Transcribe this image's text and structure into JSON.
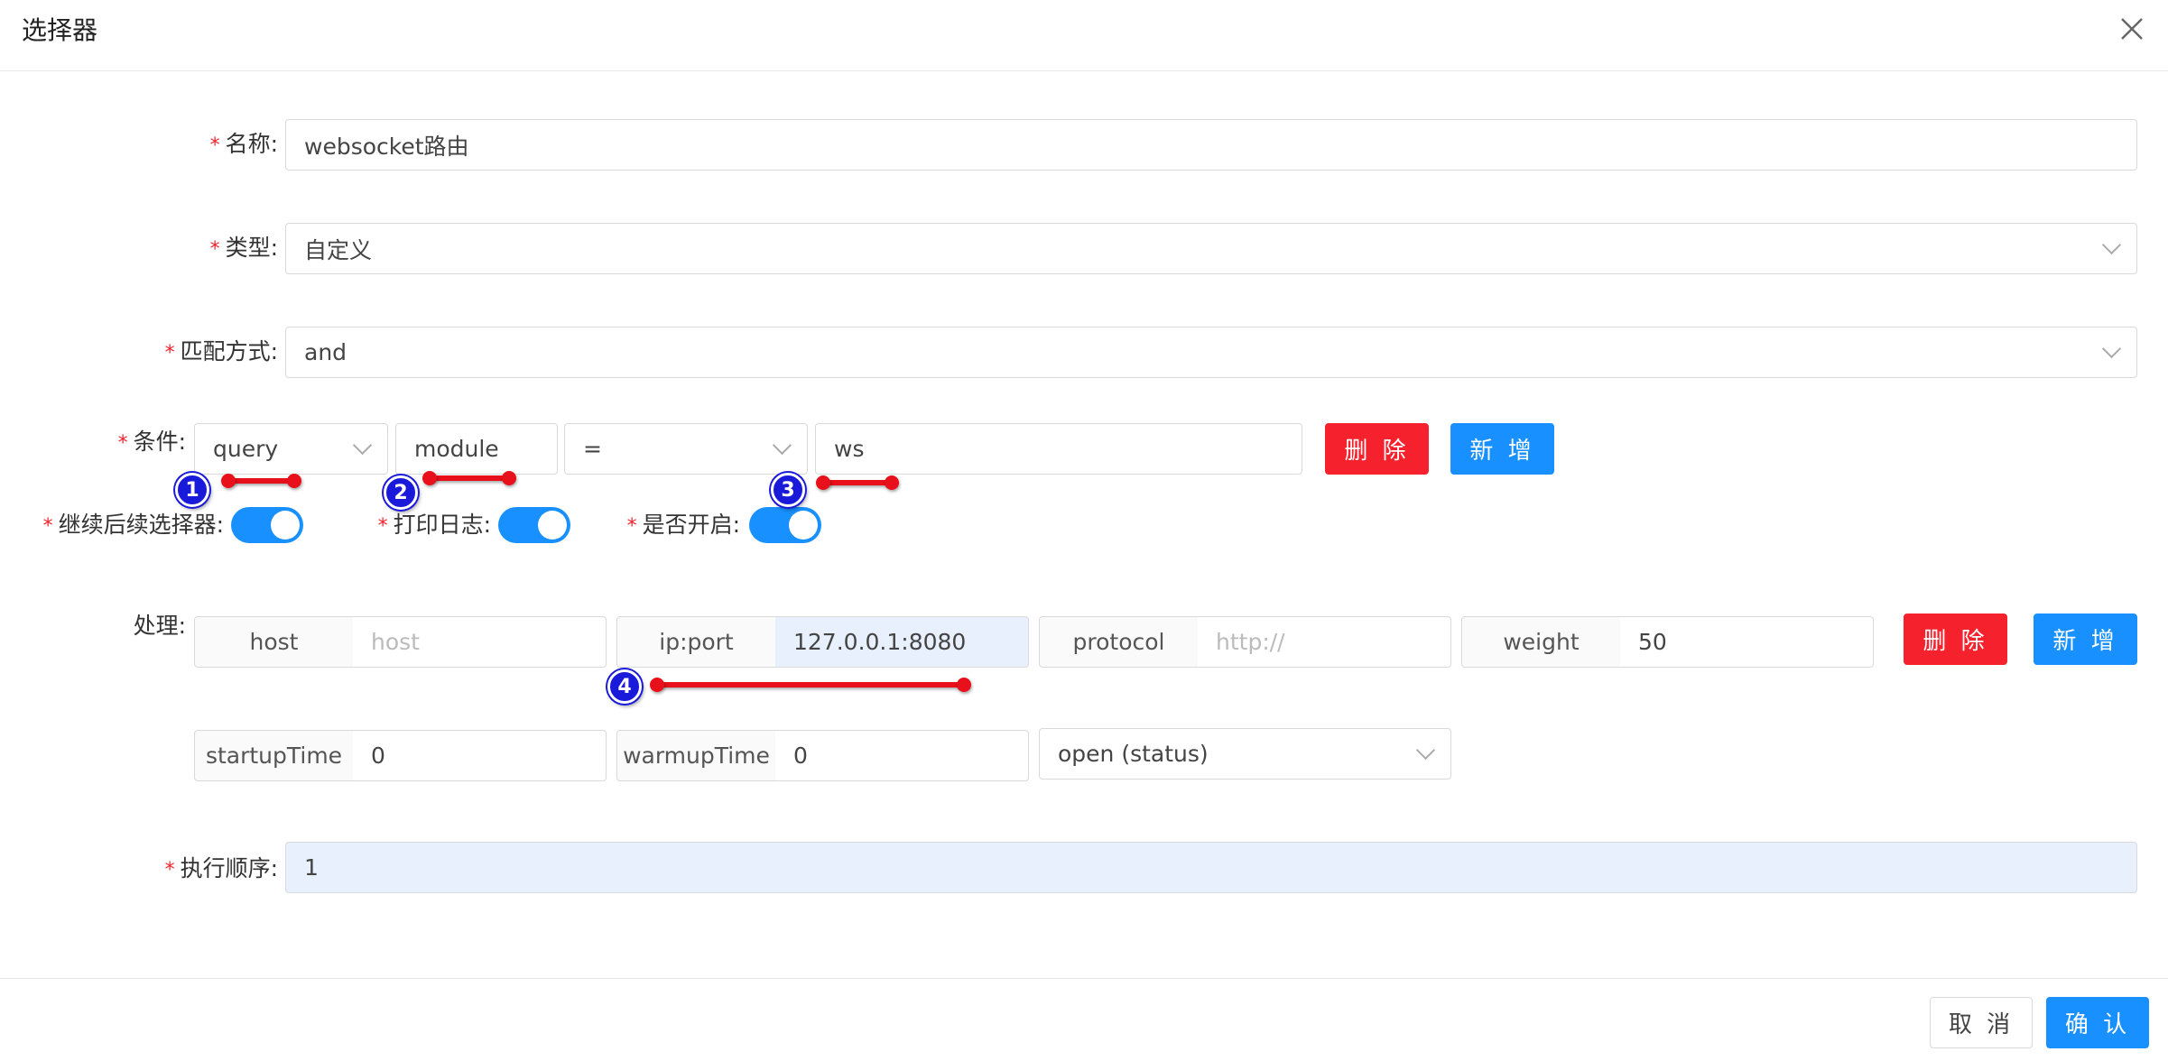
{
  "dialog": {
    "title": "选择器",
    "fields": {
      "name": {
        "label": "名称:",
        "value": "websocket路由"
      },
      "type": {
        "label": "类型:",
        "value": "自定义"
      },
      "match_mode": {
        "label": "匹配方式:",
        "value": "and"
      },
      "condition": {
        "label": "条件:",
        "param_type": "query",
        "param_name": "module",
        "operator": "=",
        "param_value": "ws",
        "delete_label": "删 除",
        "add_label": "新 增"
      },
      "continued": {
        "label": "继续后续选择器:",
        "on": true
      },
      "logged": {
        "label": "打印日志:",
        "on": true
      },
      "enabled": {
        "label": "是否开启:",
        "on": true
      },
      "handle": {
        "label": "处理:",
        "host_addon": "host",
        "host_placeholder": "host",
        "ipport_addon": "ip:port",
        "ipport_value": "127.0.0.1:8080",
        "protocol_addon": "protocol",
        "protocol_placeholder": "http://",
        "weight_addon": "weight",
        "weight_value": "50",
        "startup_addon": "startupTime",
        "startup_value": "0",
        "warmup_addon": "warmupTime",
        "warmup_value": "0",
        "status_value": "open (status)",
        "delete_label": "删 除",
        "add_label": "新 增"
      },
      "sort": {
        "label": "执行顺序:",
        "value": "1"
      }
    },
    "footer": {
      "cancel_label": "取 消",
      "confirm_label": "确 认"
    }
  },
  "annotations": [
    "1",
    "2",
    "3",
    "4"
  ],
  "colors": {
    "primary": "#1890ff",
    "danger": "#f5222d",
    "marker": "#1a1adb",
    "annotation_line": "#e8101a"
  }
}
